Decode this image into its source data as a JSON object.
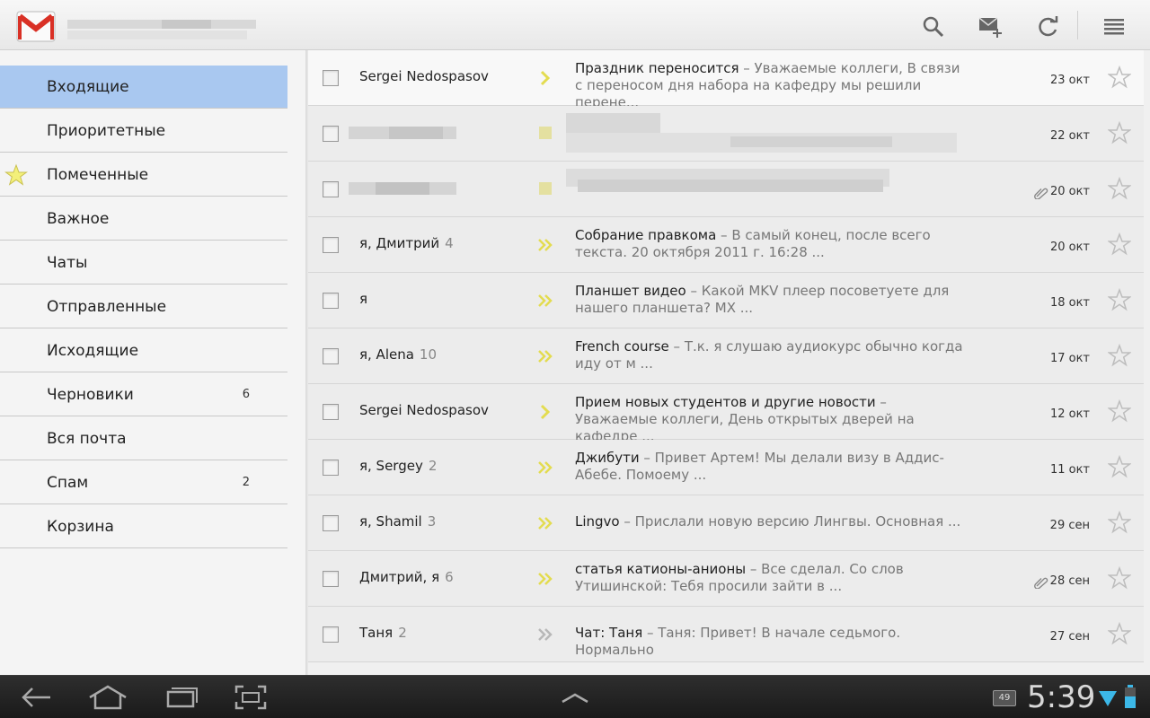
{
  "nav": [
    {
      "label": "Входящие",
      "count": "",
      "active": true
    },
    {
      "label": "Приоритетные",
      "count": ""
    },
    {
      "label": "Помеченные",
      "count": "",
      "star": true
    },
    {
      "label": "Важное",
      "count": ""
    },
    {
      "label": "Чаты",
      "count": ""
    },
    {
      "label": "Отправленные",
      "count": ""
    },
    {
      "label": "Исходящие",
      "count": ""
    },
    {
      "label": "Черновики",
      "count": "6"
    },
    {
      "label": "Вся почта",
      "count": ""
    },
    {
      "label": "Спам",
      "count": "2"
    },
    {
      "label": "Корзина",
      "count": ""
    }
  ],
  "messages": [
    {
      "sender": "Sergei Nedospasov",
      "count": "",
      "subject": "Праздник переносится",
      "snippet": " – Уважаемые коллеги, В связи с переносом дня набора на кафедру мы решили перене...",
      "date": "23 окт",
      "unread": true,
      "importance": "single",
      "attachment": false
    },
    {
      "sender": "",
      "count": "",
      "subject": "",
      "snippet": "",
      "date": "22 окт",
      "unread": false,
      "importance": "blurred",
      "attachment": false,
      "blurred": true
    },
    {
      "sender": "",
      "count": "",
      "subject": "",
      "snippet": "",
      "date": "20 окт",
      "unread": false,
      "importance": "blurred",
      "attachment": true,
      "blurred": true
    },
    {
      "sender": "я, Дмитрий",
      "count": "4",
      "subject": "Собрание правкома",
      "snippet": " – В самый конец, после всего текста. 20 октября 2011 г. 16:28 ...",
      "date": "20 окт",
      "unread": false,
      "importance": "double",
      "attachment": false
    },
    {
      "sender": "я",
      "count": "",
      "subject": "Планшет видео",
      "snippet": " – Какой MKV плеер посоветуете для нашего планшета? MX ...",
      "date": "18 окт",
      "unread": false,
      "importance": "double",
      "attachment": false
    },
    {
      "sender": "я, Alena",
      "count": "10",
      "subject": "French course",
      "snippet": " – Т.к. я слушаю аудиокурс обычно когда иду от м ...",
      "date": "17 окт",
      "unread": false,
      "importance": "double",
      "attachment": false
    },
    {
      "sender": "Sergei Nedospasov",
      "count": "",
      "subject": "Прием новых студентов и другие новости",
      "snippet": " – Уважаемые коллеги, День открытых дверей на кафедре ...",
      "date": "12 окт",
      "unread": false,
      "importance": "single",
      "attachment": false
    },
    {
      "sender": "я, Sergey",
      "count": "2",
      "subject": "Джибути",
      "snippet": " – Привет Артем! Мы делали визу в Аддис-Абебе. Помоему ...",
      "date": "11 окт",
      "unread": false,
      "importance": "double",
      "attachment": false
    },
    {
      "sender": "я, Shamil",
      "count": "3",
      "subject": "Lingvo",
      "snippet": " – Прислали новую версию Лингвы. Основная ...",
      "date": "29 сен",
      "unread": false,
      "importance": "double",
      "attachment": false
    },
    {
      "sender": "Дмитрий, я",
      "count": "6",
      "subject": "статья катионы-анионы",
      "snippet": " – Все сделал. Со слов Утишинской: Тебя просили зайти в ...",
      "date": "28 сен",
      "unread": false,
      "importance": "double",
      "attachment": true
    },
    {
      "sender": "Таня",
      "count": "2",
      "subject": "Чат: Таня",
      "snippet": " – Таня: Привет! В начале седьмого. Нормально",
      "date": "27 сен",
      "unread": false,
      "importance": "double-gray",
      "attachment": false
    }
  ],
  "toolbar": {
    "icons": [
      "search-icon",
      "compose-icon",
      "refresh-icon",
      "menu-icon"
    ]
  },
  "system": {
    "clock": "5:39",
    "notification_count": "49"
  },
  "colors": {
    "active_nav": "#a9c8f0",
    "importance_yellow": "#e8e060",
    "gmail_red": "#d93025"
  }
}
